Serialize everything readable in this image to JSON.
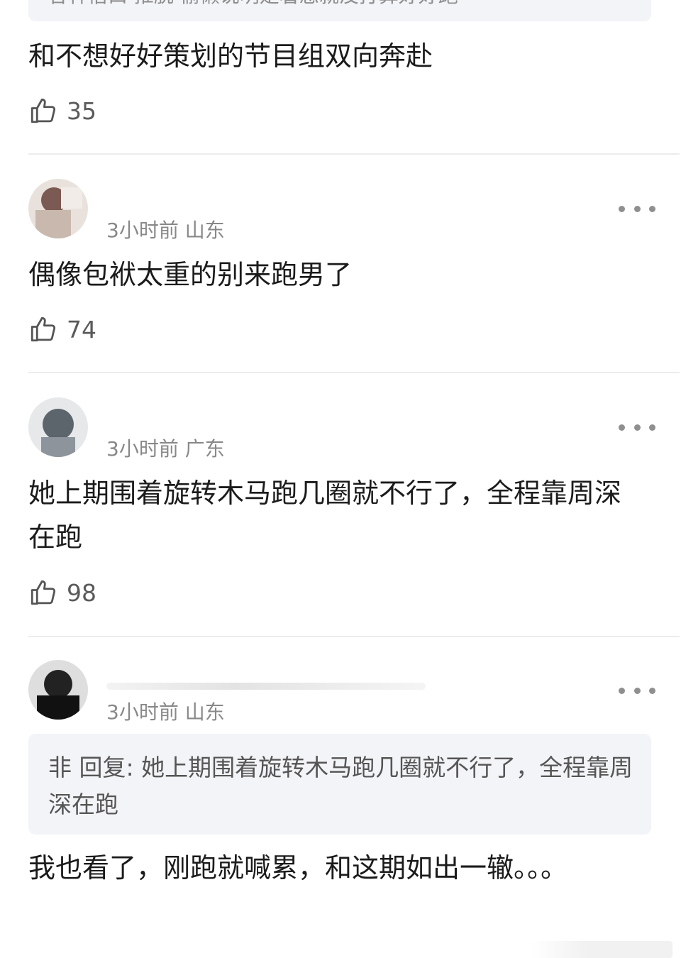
{
  "quote_top": {
    "text": "各种借口 推脱 偷懒说明是着急就没打算好好跑"
  },
  "comments": [
    {
      "text": "和不想好好策划的节目组双向奔赴",
      "likes": "35"
    },
    {
      "meta": "3小时前 山东",
      "text": "偶像包袱太重的别来跑男了",
      "likes": "74"
    },
    {
      "meta": "3小时前 广东",
      "text": "她上期围着旋转木马跑几圈就不行了，全程靠周深在跑",
      "likes": "98"
    },
    {
      "meta": "3小时前 山东",
      "quote": "非 回复: 她上期围着旋转木马跑几圈就不行了，全程靠周深在跑",
      "text": "我也看了，刚跑就喊累，和这期如出一辙。。。"
    }
  ],
  "colors": {
    "divider": "#ececec",
    "quote_bg": "#f3f4f7",
    "meta": "#888888",
    "text": "#1b1b1b"
  },
  "icons": [
    "thumbs-up-icon",
    "more-dots-icon",
    "avatar"
  ]
}
